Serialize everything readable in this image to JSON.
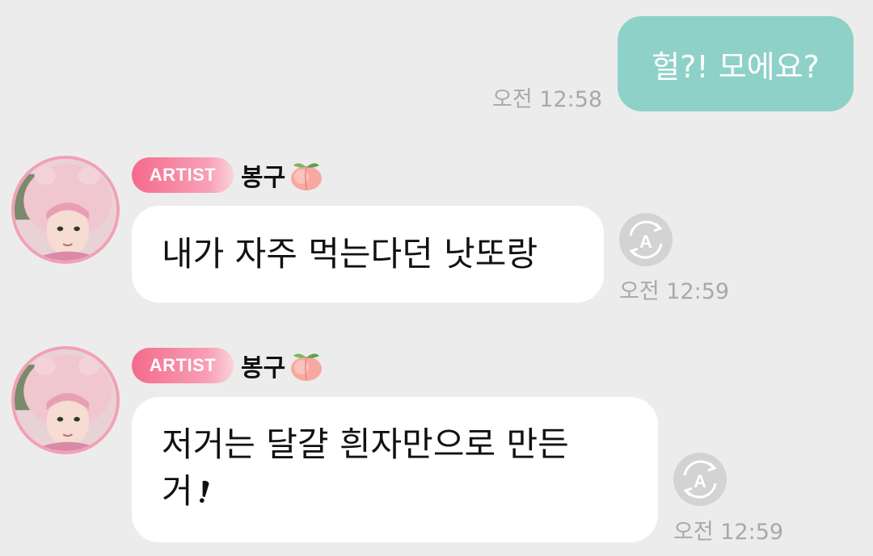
{
  "messages": [
    {
      "type": "outgoing",
      "text": "헐?! 모에요?",
      "time": "오전 12:58"
    },
    {
      "type": "incoming",
      "badge": "ARTIST",
      "sender": "봉구",
      "sender_emoji": "peach-icon",
      "text": "내가 자주 먹는다던 낫또랑",
      "time": "오전 12:59"
    },
    {
      "type": "incoming",
      "badge": "ARTIST",
      "sender": "봉구",
      "sender_emoji": "peach-icon",
      "text_line1": "저거는 달걀 흰자만으로 만든",
      "text_line2": "거",
      "time": "오전 12:59"
    }
  ],
  "colors": {
    "background": "#ececec",
    "outgoing_bubble": "#8ed1c9",
    "incoming_bubble": "#ffffff",
    "badge": "#f46a8c",
    "avatar_border": "#f2a0b6",
    "timestamp": "#a9a9a9"
  }
}
